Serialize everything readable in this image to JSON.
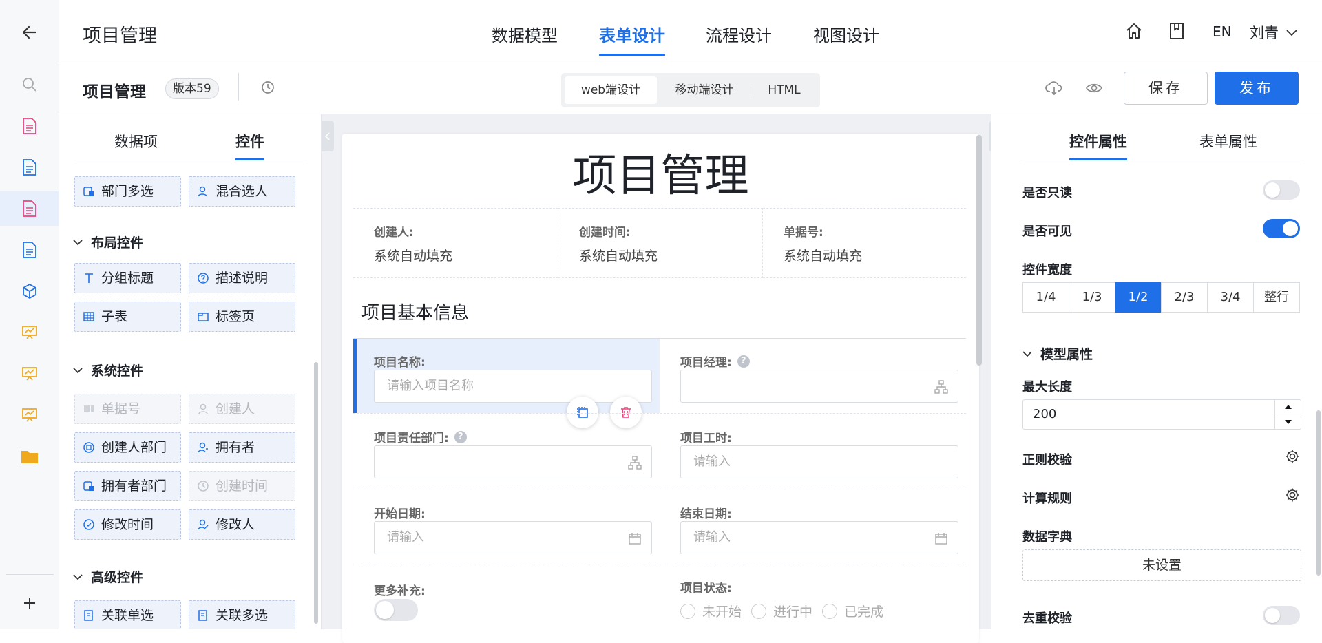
{
  "app": {
    "title": "项目管理",
    "lang": "EN",
    "user": "刘青"
  },
  "main_tabs": [
    {
      "label": "数据模型"
    },
    {
      "label": "表单设计"
    },
    {
      "label": "流程设计"
    },
    {
      "label": "视图设计"
    }
  ],
  "subbar": {
    "title": "项目管理",
    "version": "版本59",
    "modes": [
      "web端设计",
      "移动端设计",
      "HTML"
    ],
    "save_label": "保存",
    "publish_label": "发布"
  },
  "left_panel": {
    "tabs": [
      "数据项",
      "控件"
    ],
    "top_controls": [
      "部门多选",
      "混合选人"
    ],
    "sections": [
      {
        "title": "布局控件",
        "items": [
          "分组标题",
          "描述说明",
          "子表",
          "标签页"
        ]
      },
      {
        "title": "系统控件",
        "items": [
          "单据号",
          "创建人",
          "创建人部门",
          "拥有者",
          "拥有者部门",
          "创建时间",
          "修改时间",
          "修改人"
        ]
      },
      {
        "title": "高级控件",
        "items": [
          "关联单选",
          "关联多选"
        ]
      }
    ]
  },
  "form": {
    "title": "项目管理",
    "system_fields": [
      {
        "label": "创建人:",
        "value": "系统自动填充"
      },
      {
        "label": "创建时间:",
        "value": "系统自动填充"
      },
      {
        "label": "单据号:",
        "value": "系统自动填充"
      }
    ],
    "group_title": "项目基本信息",
    "fields": {
      "name": {
        "label": "项目名称:",
        "placeholder": "请输入项目名称"
      },
      "manager": {
        "label": "项目经理:"
      },
      "dept": {
        "label": "项目责任部门:"
      },
      "hours": {
        "label": "项目工时:",
        "placeholder": "请输入"
      },
      "start": {
        "label": "开始日期:",
        "placeholder": "请输入"
      },
      "end": {
        "label": "结束日期:",
        "placeholder": "请输入"
      },
      "more": {
        "label": "更多补充:"
      },
      "status": {
        "label": "项目状态:",
        "options": [
          "未开始",
          "进行中",
          "已完成"
        ]
      }
    }
  },
  "right_panel": {
    "tabs": [
      "控件属性",
      "表单属性"
    ],
    "readonly_label": "是否只读",
    "readonly": false,
    "visible_label": "是否可见",
    "visible": true,
    "width_label": "控件宽度",
    "width_options": [
      "1/4",
      "1/3",
      "1/2",
      "2/3",
      "3/4",
      "整行"
    ],
    "width_selected": "1/2",
    "model_section": "模型属性",
    "maxlen_label": "最大长度",
    "maxlen_value": "200",
    "regex_label": "正则校验",
    "calc_label": "计算规则",
    "dict_label": "数据字典",
    "dict_value": "未设置",
    "dedupe_label": "去重校验",
    "dedupe": false
  },
  "colors": {
    "accent": "#1e6fe8",
    "rail_pink": "#e8437b",
    "rail_blue": "#1e6fe8",
    "rail_yellow": "#f0a81c"
  }
}
